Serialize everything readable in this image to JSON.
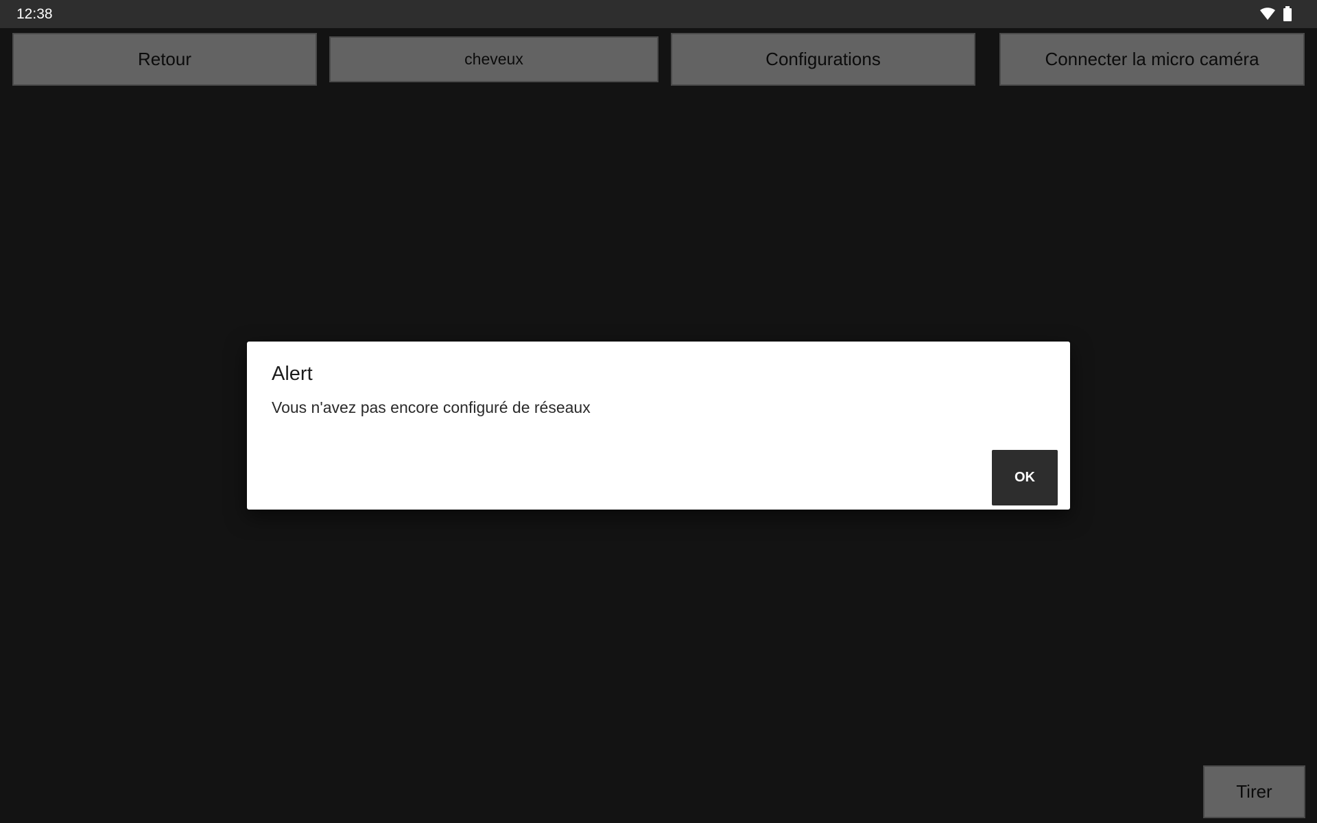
{
  "status_bar": {
    "time": "12:38",
    "icons": [
      "wifi-icon",
      "battery-icon"
    ]
  },
  "toolbar": {
    "back_label": "Retour",
    "selected_item_label": "cheveux",
    "settings_label": "Configurations",
    "connect_camera_label": "Connecter la micro caméra"
  },
  "actions": {
    "fire_label": "Tirer"
  },
  "dialog": {
    "title": "Alert",
    "message": "Vous n'avez pas encore configuré de réseaux",
    "ok_label": "OK"
  },
  "colors": {
    "background": "#131313",
    "status_bar": "#2e2e2e",
    "button": "#636363",
    "dialog": "#ffffff",
    "ok_button": "#2d2d2d"
  }
}
